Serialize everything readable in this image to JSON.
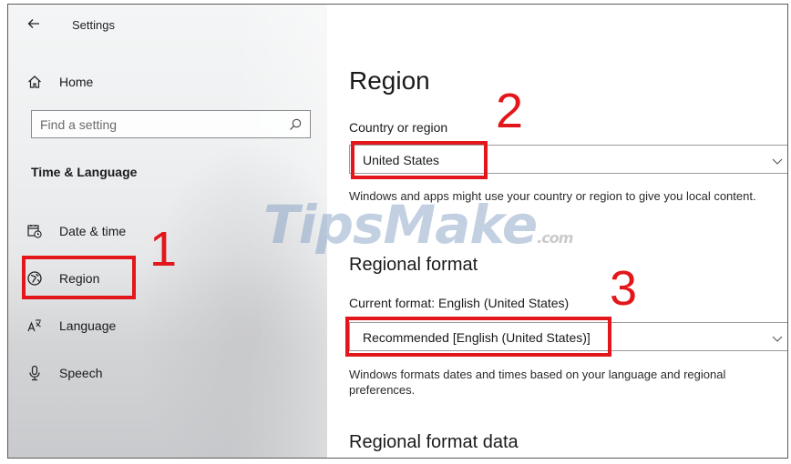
{
  "window": {
    "title": "Settings"
  },
  "sidebar": {
    "home_label": "Home",
    "search_placeholder": "Find a setting",
    "section_heading": "Time & Language",
    "items": [
      {
        "label": "Date & time",
        "icon": "calendar-clock-icon"
      },
      {
        "label": "Region",
        "icon": "globe-icon"
      },
      {
        "label": "Language",
        "icon": "language-icon"
      },
      {
        "label": "Speech",
        "icon": "microphone-icon"
      }
    ]
  },
  "main": {
    "title": "Region",
    "country_label": "Country or region",
    "country_value": "United States",
    "country_desc": "Windows and apps might use your country or region to give you local content.",
    "regional_format_heading": "Regional format",
    "current_format_label": "Current format: English (United States)",
    "format_value": "Recommended [English (United States)]",
    "format_desc": "Windows formats dates and times based on your language and regional preferences.",
    "regional_format_data_heading": "Regional format data"
  },
  "annotations": {
    "num1": "1",
    "num2": "2",
    "num3": "3",
    "color": "#e3171b"
  },
  "watermark": {
    "text": "TipsMake",
    "suffix": ".com"
  }
}
